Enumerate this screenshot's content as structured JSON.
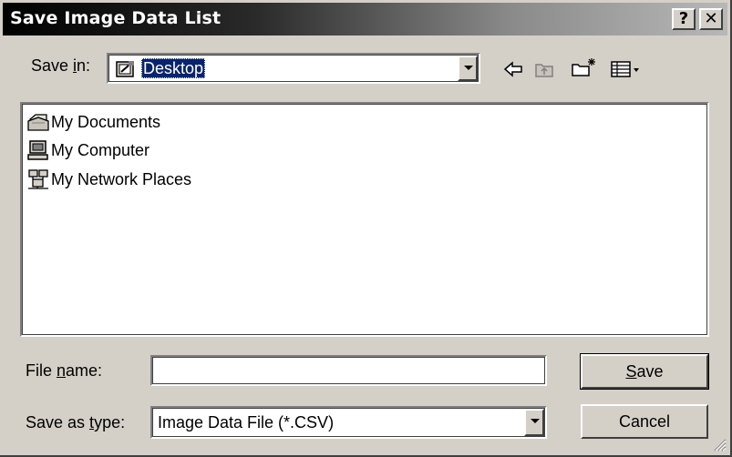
{
  "window": {
    "title": "Save Image Data List",
    "help_label": "?",
    "close_label": "✕"
  },
  "save_in": {
    "label_prefix": "Save ",
    "label_underlined": "i",
    "label_suffix": "n:",
    "value": "Desktop"
  },
  "toolbar": {
    "back_icon": "back-arrow-icon",
    "up_icon": "up-folder-icon",
    "new_folder_icon": "new-folder-icon",
    "view_menu_icon": "view-menu-icon"
  },
  "files": [
    {
      "label": "My Documents",
      "icon": "my-documents-icon"
    },
    {
      "label": "My Computer",
      "icon": "my-computer-icon"
    },
    {
      "label": "My Network Places",
      "icon": "network-places-icon"
    }
  ],
  "file_name": {
    "label_prefix": "File ",
    "label_underlined": "n",
    "label_suffix": "ame:",
    "value": "",
    "placeholder": ""
  },
  "save_as_type": {
    "label_prefix": "Save as ",
    "label_underlined": "t",
    "label_suffix": "ype:",
    "value": "Image Data File (*.CSV)"
  },
  "buttons": {
    "save_underlined": "S",
    "save_rest": "ave",
    "cancel": "Cancel"
  }
}
